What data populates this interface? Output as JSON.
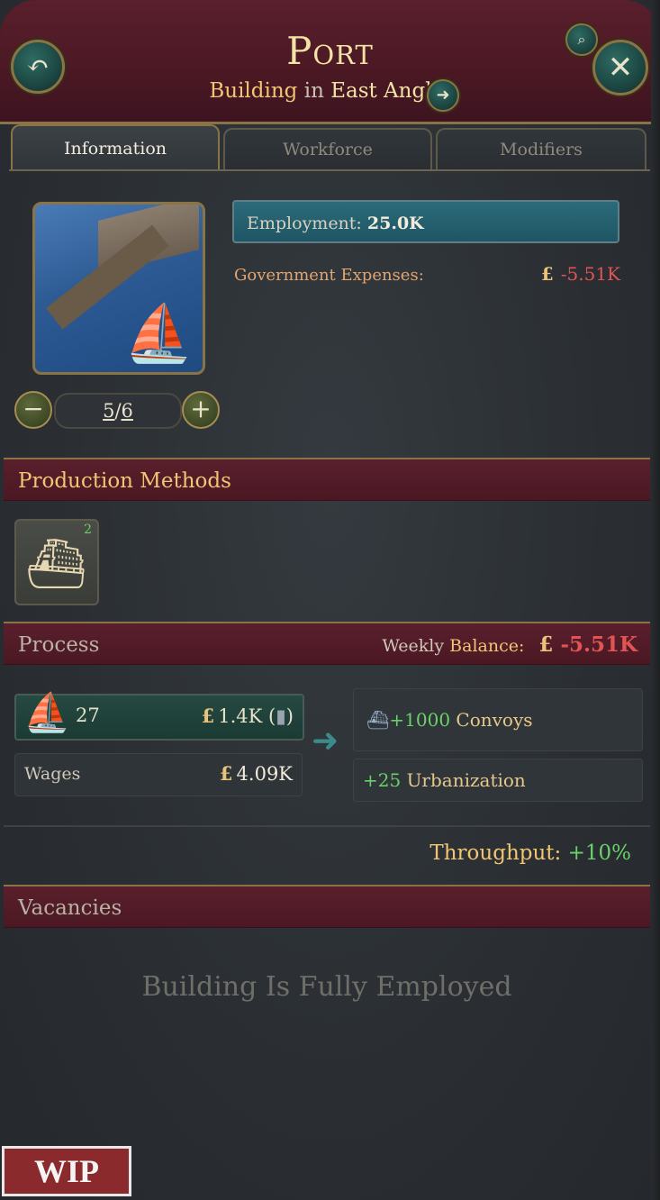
{
  "header": {
    "title": "Port",
    "subtitle_building": "Building",
    "subtitle_in": "in",
    "subtitle_region": "East Anglia"
  },
  "icons": {
    "back": "back-arrow-icon",
    "close": "close-icon",
    "search": "search-icon",
    "goto": "arrow-right-icon"
  },
  "tabs": [
    {
      "label": "Information",
      "active": true
    },
    {
      "label": "Workforce",
      "active": false
    },
    {
      "label": "Modifiers",
      "active": false
    }
  ],
  "levels": {
    "current": "5",
    "sep": "/",
    "max": "6"
  },
  "employment": {
    "label": "Employment:",
    "value": "25.0K"
  },
  "government_expenses": {
    "label": "Government Expenses:",
    "currency": "£",
    "value": "-5.51K"
  },
  "sections": {
    "production_methods": "Production Methods",
    "process": "Process",
    "vacancies": "Vacancies"
  },
  "production_method": {
    "badge": "2"
  },
  "weekly_balance": {
    "label1": "Weekly",
    "label2": "Balance:",
    "currency": "£",
    "value": "-5.51K"
  },
  "input": {
    "count": "27",
    "currency": "£",
    "value": "1.4K (",
    "close": ")"
  },
  "wages": {
    "label": "Wages",
    "currency": "£",
    "value": "4.09K"
  },
  "outputs": [
    {
      "amount": "+1000",
      "label": "Convoys"
    },
    {
      "amount": "+25",
      "label": "Urbanization"
    }
  ],
  "throughput": {
    "label": "Throughput:",
    "value": "+10%"
  },
  "vacancies_message": "Building Is Fully Employed",
  "wip_label": "WIP",
  "colors": {
    "accent_gold": "#f0c673",
    "negative": "#e25454",
    "positive": "#6ad16a",
    "header_red": "#5a1f2c"
  }
}
